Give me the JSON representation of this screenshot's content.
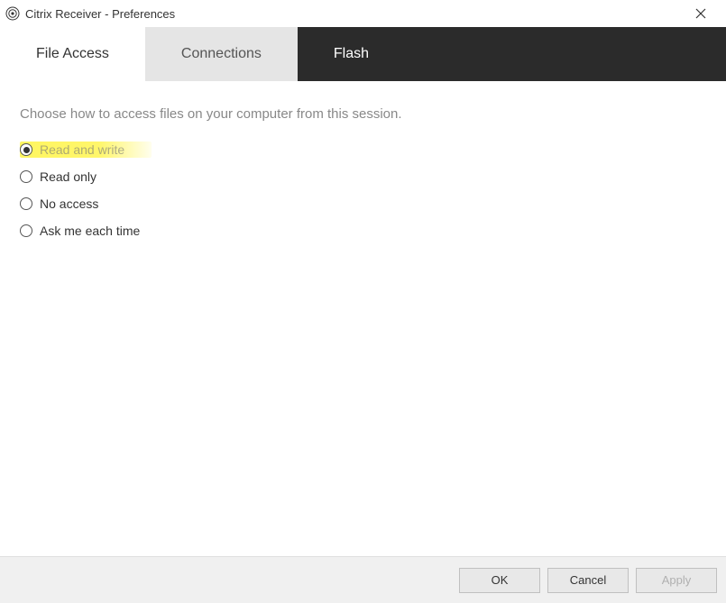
{
  "titlebar": {
    "title": "Citrix Receiver - Preferences"
  },
  "tabs": {
    "file_access": "File Access",
    "connections": "Connections",
    "flash": "Flash"
  },
  "content": {
    "instruction": "Choose how to access files on your computer from this session.",
    "options": {
      "read_write": "Read and write",
      "read_only": "Read only",
      "no_access": "No access",
      "ask_each_time": "Ask me each time"
    },
    "selected": "read_write"
  },
  "buttons": {
    "ok": "OK",
    "cancel": "Cancel",
    "apply": "Apply"
  }
}
